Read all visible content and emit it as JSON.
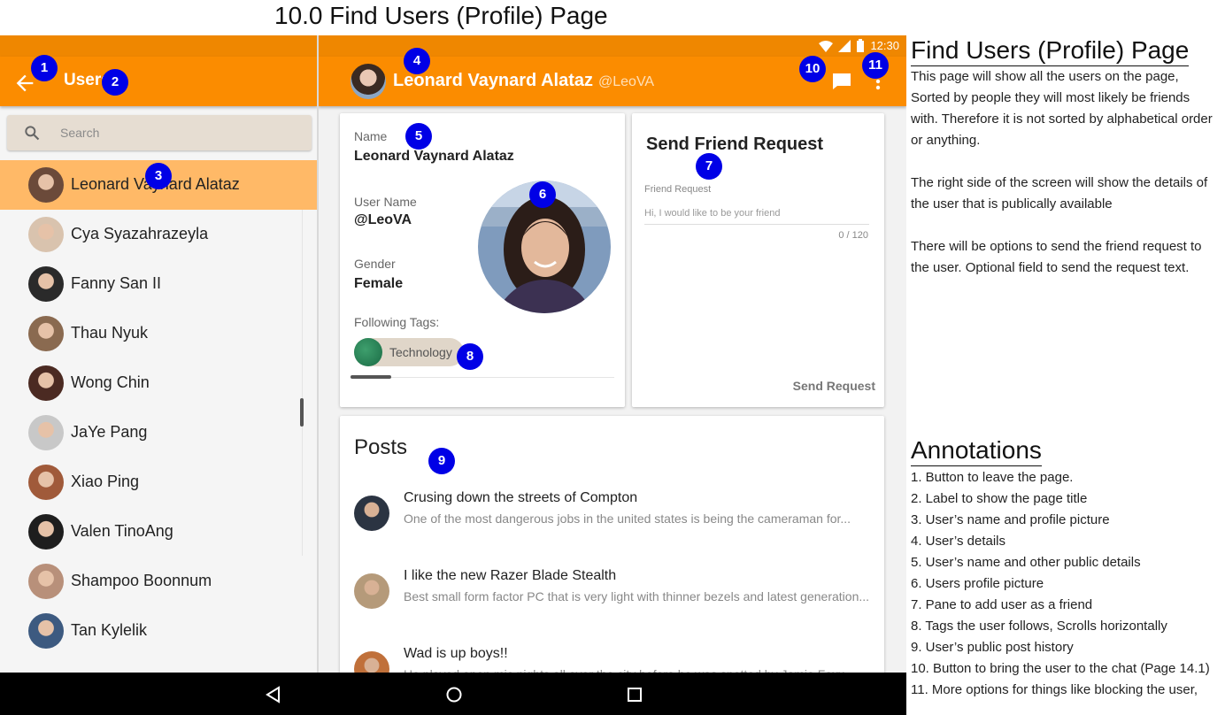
{
  "heading": "10.0 Find Users (Profile) Page",
  "status_bar": {
    "time": "12:30"
  },
  "left_app_bar": {
    "title": "Users"
  },
  "search": {
    "placeholder": "Search"
  },
  "users": [
    {
      "name": "Leonard Vaynard Alataz",
      "selected": true,
      "avatar_color": "#6b4a3a"
    },
    {
      "name": "Cya Syazahrazeyla",
      "selected": false,
      "avatar_color": "#d9c3ae"
    },
    {
      "name": "Fanny San II",
      "selected": false,
      "avatar_color": "#2a2a2a"
    },
    {
      "name": "Thau Nyuk",
      "selected": false,
      "avatar_color": "#8a6a50"
    },
    {
      "name": "Wong Chin",
      "selected": false,
      "avatar_color": "#4b2a22"
    },
    {
      "name": "JaYe Pang",
      "selected": false,
      "avatar_color": "#c8c8c8"
    },
    {
      "name": "Xiao Ping",
      "selected": false,
      "avatar_color": "#a05a3a"
    },
    {
      "name": "Valen TinoAng",
      "selected": false,
      "avatar_color": "#1e1e1e"
    },
    {
      "name": "Shampoo Boonnum",
      "selected": false,
      "avatar_color": "#b8907a"
    },
    {
      "name": "Tan Kylelik",
      "selected": false,
      "avatar_color": "#3d5a80"
    }
  ],
  "profile_header": {
    "name": "Leonard Vaynard Alataz",
    "handle": "@LeoVA"
  },
  "details": {
    "name_label": "Name",
    "name_value": "Leonard Vaynard Alataz",
    "username_label": "User Name",
    "username_value": "@LeoVA",
    "gender_label": "Gender",
    "gender_value": "Female",
    "tags_label": "Following Tags:",
    "tags": [
      "Technology"
    ]
  },
  "friend_request": {
    "title": "Send Friend Request",
    "field_label": "Friend Request",
    "placeholder": "Hi, I would like to be your friend",
    "counter": "0 / 120",
    "send_label": "Send Request"
  },
  "posts": {
    "title": "Posts",
    "items": [
      {
        "title": "Crusing down the streets of Compton",
        "snippet": "One of the most dangerous jobs in the united states is being the cameraman for...",
        "avatar_color": "#2b3442"
      },
      {
        "title": "I like the new Razer Blade Stealth",
        "snippet": "Best small form factor PC that is very light with thinner bezels and latest generation...",
        "avatar_color": "#b59a7a"
      },
      {
        "title": "Wad is up boys!!",
        "snippet": "He played open mic nights all over the city before he was spotted by Jamie Foxx...",
        "avatar_color": "#c0703a"
      }
    ]
  },
  "markers": [
    "1",
    "2",
    "3",
    "4",
    "5",
    "6",
    "7",
    "8",
    "9",
    "10",
    "11"
  ],
  "doc": {
    "heading": "Find Users (Profile) Page",
    "paragraphs": [
      "This page will show all the users on the page, Sorted by people they will most likely be friends with. Therefore it is not sorted by alphabetical order or anything.",
      "The right side of the screen will show the details of the user that is publically available",
      "There will be options to send the friend request to the user. Optional field to send the request text."
    ],
    "annotations_heading": "Annotations",
    "annotations": [
      "1. Button to leave the page.",
      "2. Label to show the page title",
      "3. User’s name and profile picture",
      "4. User’s details",
      "5. User’s name and other public details",
      "6. Users profile picture",
      "7. Pane to add user as a friend",
      "8. Tags the user follows, Scrolls horizontally",
      "9. User’s public post history",
      "10. Button to bring the user to the chat (Page 14.1)",
      "11. More options for things like blocking the user,"
    ]
  },
  "colors": {
    "app_bar": "#fb8c00",
    "status_bar": "#ef8700",
    "selected_row": "#ffb967",
    "marker": "#0000e6"
  }
}
